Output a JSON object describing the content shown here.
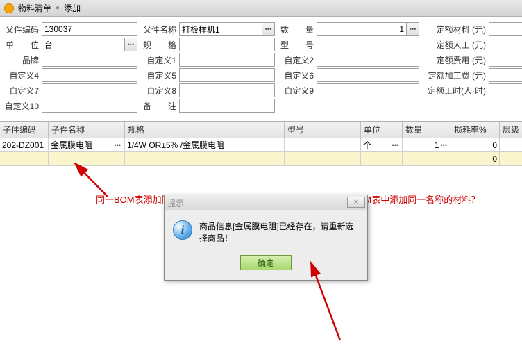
{
  "titlebar": {
    "text": "物料清单",
    "action": "添加"
  },
  "form": {
    "parent_code": {
      "label": "父件编码",
      "value": "130037"
    },
    "parent_name": {
      "label": "父件名称",
      "value": "打板样机1"
    },
    "qty": {
      "label": "数　　量",
      "value": "1"
    },
    "mat_cost": {
      "label": "定额材料 (元)",
      "value": ""
    },
    "unit": {
      "label": "单　　位",
      "value": "台"
    },
    "spec": {
      "label": "规　　格",
      "value": ""
    },
    "model": {
      "label": "型　　号",
      "value": ""
    },
    "labor_cost": {
      "label": "定额人工 (元)",
      "value": ""
    },
    "brand": {
      "label": "品牌",
      "value": ""
    },
    "c1": {
      "label": "自定义1",
      "value": ""
    },
    "c2": {
      "label": "自定义2",
      "value": ""
    },
    "fee_cost": {
      "label": "定额费用 (元)",
      "value": ""
    },
    "c4": {
      "label": "自定义4",
      "value": ""
    },
    "c5": {
      "label": "自定义5",
      "value": ""
    },
    "c6": {
      "label": "自定义6",
      "value": ""
    },
    "proc_cost": {
      "label": "定额加工费 (元)",
      "value": ""
    },
    "c7": {
      "label": "自定义7",
      "value": ""
    },
    "c8": {
      "label": "自定义8",
      "value": ""
    },
    "c9": {
      "label": "自定义9",
      "value": ""
    },
    "hours": {
      "label": "定额工时(人·时)",
      "value": ""
    },
    "c10": {
      "label": "自定义10",
      "value": ""
    },
    "remark": {
      "label": "备　　注",
      "value": ""
    }
  },
  "grid": {
    "headers": [
      "子件编码",
      "子件名称",
      "规格",
      "型号",
      "单位",
      "数量",
      "损耗率%",
      "层级"
    ],
    "rows": [
      {
        "code": "202-DZ001",
        "name": "金属膜电阻",
        "spec": "1/4W OR±5% /金属膜电阻",
        "model": "",
        "unit": "个",
        "qty": "1",
        "loss": "0",
        "level": ""
      },
      {
        "code": "",
        "name": "",
        "spec": "",
        "model": "",
        "unit": "",
        "qty": "",
        "loss": "0",
        "level": ""
      }
    ]
  },
  "annotation": "同一BOM表添加同一名称的材料，出现如下提示框，如何在同一BOM表中添加同一名称的材料？",
  "dialog": {
    "title": "提示",
    "message": "商品信息[金属膜电阻]已经存在，请重新选择商品！",
    "ok": "确定"
  },
  "icons": {
    "dots": "•••"
  }
}
